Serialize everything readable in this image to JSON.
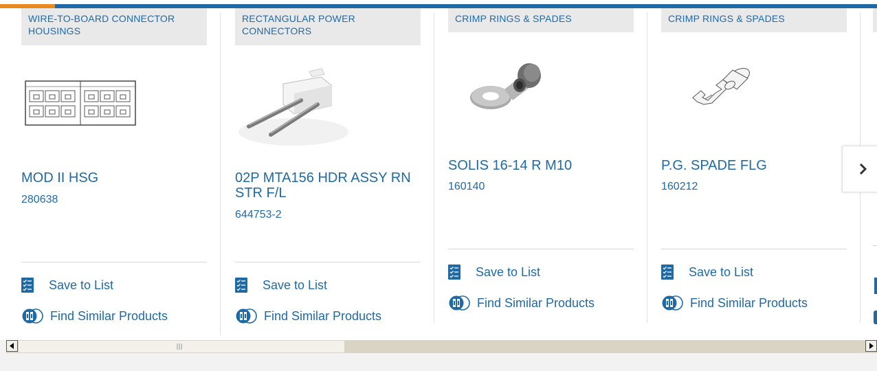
{
  "products": [
    {
      "category": "WIRE-TO-BOARD CONNECTOR HOUSINGS",
      "name": "MOD II HSG",
      "part_number": "280638",
      "save_label": "Save to List",
      "similar_label": "Find Similar Products",
      "image_icon": "connector-housing-image"
    },
    {
      "category": "RECTANGULAR POWER CONNECTORS",
      "name": "02P MTA156 HDR ASSY RN STR F/L",
      "part_number": "644753-2",
      "save_label": "Save to List",
      "similar_label": "Find Similar Products",
      "image_icon": "header-assembly-image"
    },
    {
      "category": "CRIMP RINGS & SPADES",
      "name": "SOLIS 16-14 R M10",
      "part_number": "160140",
      "save_label": "Save to List",
      "similar_label": "Find Similar Products",
      "image_icon": "ring-terminal-image"
    },
    {
      "category": "CRIMP RINGS & SPADES",
      "name": "P.G. SPADE FLG",
      "part_number": "160212",
      "save_label": "Save to List",
      "similar_label": "Find Similar Products",
      "image_icon": "spade-terminal-image"
    }
  ],
  "carousel": {
    "next_icon": "chevron-right-icon"
  },
  "scrollbar": {
    "left_icon": "arrow-left-icon",
    "right_icon": "arrow-right-icon",
    "grip_icon": "grip-icon"
  },
  "colors": {
    "brand_blue": "#1f6aa5",
    "accent_orange": "#e98a1e",
    "category_bg": "#e9e9e9"
  }
}
